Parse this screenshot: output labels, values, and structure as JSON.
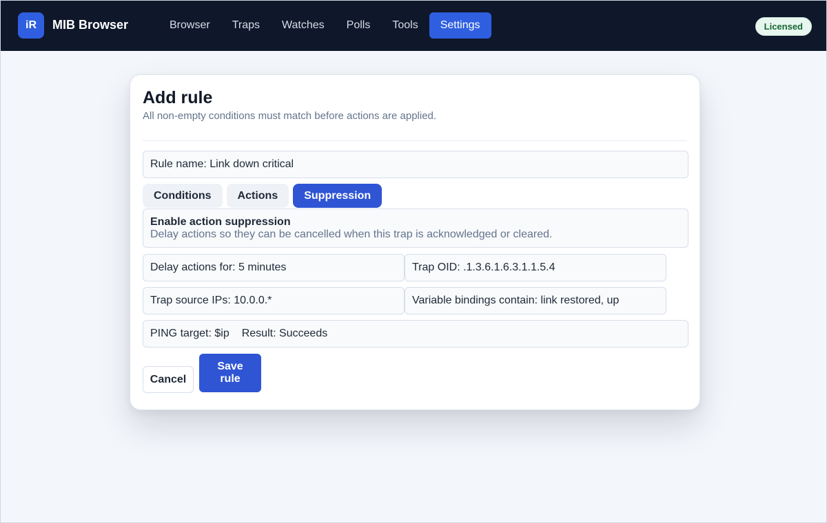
{
  "app": {
    "logo_text": "iR",
    "title": "MIB Browser",
    "license_badge": "Licensed"
  },
  "nav": {
    "items": [
      {
        "label": "Browser"
      },
      {
        "label": "Traps"
      },
      {
        "label": "Watches"
      },
      {
        "label": "Polls"
      },
      {
        "label": "Tools"
      },
      {
        "label": "Settings",
        "active": true
      }
    ]
  },
  "modal": {
    "title": "Add rule",
    "subtitle": "All non-empty conditions must match before actions are applied.",
    "rule_name": "Rule name: Link down critical",
    "tabs": [
      {
        "label": "Conditions"
      },
      {
        "label": "Actions"
      },
      {
        "label": "Suppression",
        "active": true
      }
    ],
    "suppression": {
      "title": "Enable action suppression",
      "description": "Delay actions so they can be cancelled when this trap is acknowledged or cleared."
    },
    "fields": {
      "delay": "Delay actions for: 5 minutes",
      "trap_oid": "Trap OID: .1.3.6.1.6.3.1.1.5.4",
      "source_ips": "Trap source IPs: 10.0.0.*",
      "varbinds": "Variable bindings contain: link restored, up",
      "ping_target": "PING target: $ip",
      "ping_result": "Result: Succeeds"
    },
    "buttons": {
      "cancel": "Cancel",
      "save": "Save rule"
    }
  },
  "colors": {
    "topbar": "#0f172a",
    "accent": "#2f55d4",
    "badge_text": "#166534"
  }
}
